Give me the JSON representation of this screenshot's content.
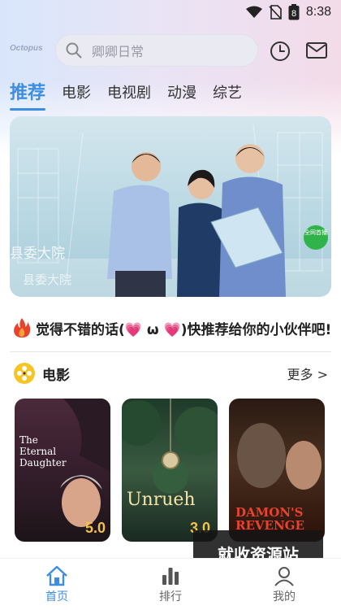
{
  "status_bar": {
    "time": "8:38",
    "battery_level": "8"
  },
  "header": {
    "logo_text": "Octopus",
    "search_placeholder": "卿卿日常"
  },
  "tabs": [
    {
      "label": "推荐",
      "active": true
    },
    {
      "label": "电影",
      "active": false
    },
    {
      "label": "电视剧",
      "active": false
    },
    {
      "label": "动漫",
      "active": false
    },
    {
      "label": "综艺",
      "active": false
    }
  ],
  "banner": {
    "overlay_text": "县委大院",
    "overlay_text_small": "县委大院",
    "badge_text": "全网首播"
  },
  "recommend_text": "觉得不错的话(💗 ω 💗)快推荐给你的小伙伴吧!",
  "section": {
    "title": "电影",
    "more_label": "更多 >"
  },
  "posters": [
    {
      "title": "The Eternal Daughter",
      "score": "5.0",
      "bg": "#3a2030"
    },
    {
      "title": "Unrueh",
      "score": "3.0",
      "bg": "#2e4a3a"
    },
    {
      "title": "DAMON'S REVENGE",
      "score": "",
      "bg": "#3a2418"
    }
  ],
  "watermark_text": "就收资源站",
  "bottom_nav": [
    {
      "label": "首页",
      "icon": "home-icon",
      "active": true
    },
    {
      "label": "排行",
      "icon": "ranking-icon",
      "active": false
    },
    {
      "label": "我的",
      "icon": "profile-icon",
      "active": false
    }
  ],
  "colors": {
    "accent": "#3d8ee0",
    "score": "#f2c14e"
  }
}
